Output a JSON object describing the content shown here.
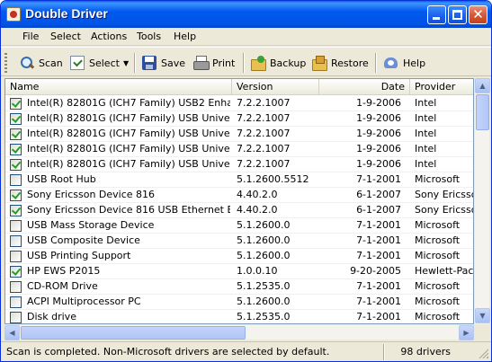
{
  "window": {
    "title": "Double Driver"
  },
  "menu": [
    "File",
    "Select",
    "Actions",
    "Tools",
    "Help"
  ],
  "toolbar": {
    "scan": "Scan",
    "select": "Select",
    "save": "Save",
    "print": "Print",
    "backup": "Backup",
    "restore": "Restore",
    "help": "Help"
  },
  "columns": {
    "name": "Name",
    "version": "Version",
    "date": "Date",
    "provider": "Provider"
  },
  "drivers": [
    {
      "checked": true,
      "name": "Intel(R) 82801G (ICH7 Family) USB2 Enhanc...",
      "version": "7.2.2.1007",
      "date": "1-9-2006",
      "provider": "Intel"
    },
    {
      "checked": true,
      "name": "Intel(R) 82801G (ICH7 Family) USB Universa...",
      "version": "7.2.2.1007",
      "date": "1-9-2006",
      "provider": "Intel"
    },
    {
      "checked": true,
      "name": "Intel(R) 82801G (ICH7 Family) USB Universa...",
      "version": "7.2.2.1007",
      "date": "1-9-2006",
      "provider": "Intel"
    },
    {
      "checked": true,
      "name": "Intel(R) 82801G (ICH7 Family) USB Universa...",
      "version": "7.2.2.1007",
      "date": "1-9-2006",
      "provider": "Intel"
    },
    {
      "checked": true,
      "name": "Intel(R) 82801G (ICH7 Family) USB Universa...",
      "version": "7.2.2.1007",
      "date": "1-9-2006",
      "provider": "Intel"
    },
    {
      "checked": false,
      "name": "USB Root Hub",
      "version": "5.1.2600.5512",
      "date": "7-1-2001",
      "provider": "Microsoft"
    },
    {
      "checked": true,
      "name": "Sony Ericsson Device 816",
      "version": "4.40.2.0",
      "date": "6-1-2007",
      "provider": "Sony Ericsson"
    },
    {
      "checked": true,
      "name": "Sony Ericsson Device 816 USB Ethernet Emu...",
      "version": "4.40.2.0",
      "date": "6-1-2007",
      "provider": "Sony Ericsson"
    },
    {
      "checked": false,
      "name": "USB Mass Storage Device",
      "version": "5.1.2600.0",
      "date": "7-1-2001",
      "provider": "Microsoft"
    },
    {
      "checked": false,
      "name": "USB Composite Device",
      "version": "5.1.2600.0",
      "date": "7-1-2001",
      "provider": "Microsoft"
    },
    {
      "checked": false,
      "name": "USB Printing Support",
      "version": "5.1.2600.0",
      "date": "7-1-2001",
      "provider": "Microsoft"
    },
    {
      "checked": true,
      "name": "HP EWS P2015",
      "version": "1.0.0.10",
      "date": "9-20-2005",
      "provider": "Hewlett-Packard"
    },
    {
      "checked": false,
      "name": "CD-ROM Drive",
      "version": "5.1.2535.0",
      "date": "7-1-2001",
      "provider": "Microsoft"
    },
    {
      "checked": false,
      "name": "ACPI Multiprocessor PC",
      "version": "5.1.2600.0",
      "date": "7-1-2001",
      "provider": "Microsoft"
    },
    {
      "checked": false,
      "name": "Disk drive",
      "version": "5.1.2535.0",
      "date": "7-1-2001",
      "provider": "Microsoft"
    }
  ],
  "status": {
    "message": "Scan is completed. Non-Microsoft drivers are selected by default.",
    "count": "98 drivers"
  },
  "icons": {
    "app": "double-driver-icon",
    "scan": "magnifier-icon",
    "select": "checklist-icon",
    "save": "floppy-disk-icon",
    "print": "printer-icon",
    "backup": "folder-add-icon",
    "restore": "folder-restore-icon",
    "help": "help-book-icon"
  },
  "colors": {
    "titlebar": "#0055e5",
    "check": "#21a121",
    "chrome": "#ece9d8",
    "list_border": "#7f9db9"
  }
}
